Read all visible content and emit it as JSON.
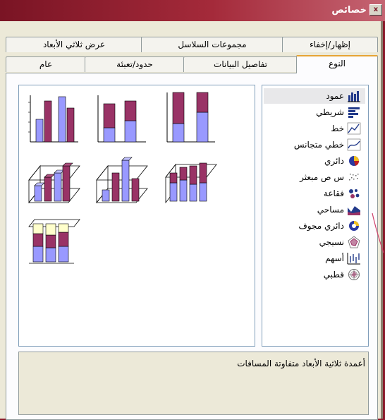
{
  "window": {
    "title": "خصائص"
  },
  "tabs": {
    "row_back": [
      "عرض ثلاثي الأبعاد",
      "مجموعات السلاسل",
      "إظهار/إخفاء"
    ],
    "row_front": [
      "عام",
      "حدود/تعبئة",
      "تفاصيل البيانات",
      "النوع"
    ]
  },
  "chart_types": [
    {
      "label": "عمود",
      "icon": "column-chart-icon"
    },
    {
      "label": "شريطي",
      "icon": "bar-chart-icon"
    },
    {
      "label": "خط",
      "icon": "line-chart-icon"
    },
    {
      "label": "خطي متجانس",
      "icon": "smooth-line-chart-icon"
    },
    {
      "label": "دائري",
      "icon": "pie-chart-icon"
    },
    {
      "label": "س ص مبعثر",
      "icon": "scatter-chart-icon"
    },
    {
      "label": "فقاعة",
      "icon": "bubble-chart-icon"
    },
    {
      "label": "مساحي",
      "icon": "area-chart-icon"
    },
    {
      "label": "دائري مجوف",
      "icon": "doughnut-chart-icon"
    },
    {
      "label": "نسيجي",
      "icon": "radar-chart-icon"
    },
    {
      "label": "أسهم",
      "icon": "stock-chart-icon"
    },
    {
      "label": "قطبي",
      "icon": "polar-chart-icon"
    }
  ],
  "selected_type": "عمود",
  "description": "أعمدة ثلاثية الأبعاد متفاوتة المسافات",
  "colors": {
    "series1": "#9999ff",
    "series2": "#993366",
    "series3": "#ffffcc",
    "tab_hot": "#e6a435"
  }
}
